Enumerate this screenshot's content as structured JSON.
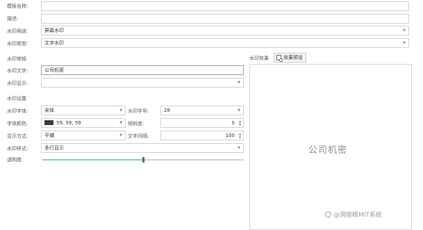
{
  "form": {
    "template_name_label": "模板名称:",
    "template_name_value": "",
    "description_label": "描述:",
    "description_value": "",
    "purpose_label": "水印用途:",
    "purpose_value": "屏幕水印",
    "type_label": "水印类型:",
    "type_value": "文字水印"
  },
  "watermark_content": {
    "section_label": "水印常规",
    "text_label": "水印文字:",
    "text_value": "公司机密",
    "display_label": "水印显示:",
    "display_value": ""
  },
  "watermark_settings": {
    "section_label": "水印设置",
    "font_label": "水印字体:",
    "font_value": "宋体",
    "font_size_label": "水印字号:",
    "font_size_value": "28",
    "color_label": "字体颜色:",
    "color_value": "59, 59, 59",
    "color_hex": "#3b3b3b",
    "tilt_label": "倾斜度:",
    "tilt_value": "0",
    "layout_label": "显示方式:",
    "layout_value": "平铺",
    "spacing_label": "文字间隔:",
    "spacing_value": "100",
    "style_label": "水印样式:",
    "style_value": "多行显示",
    "opacity_label": "透明度:",
    "opacity_fraction": 0.5
  },
  "preview": {
    "label": "水印效果",
    "button_label": "效果预览",
    "preview_text": "公司机密"
  },
  "watermark_overlay": {
    "text": "@洞察眼MIT系统"
  },
  "colors": {
    "accent": "#7ecfc0",
    "border": "#cfcfcf"
  }
}
